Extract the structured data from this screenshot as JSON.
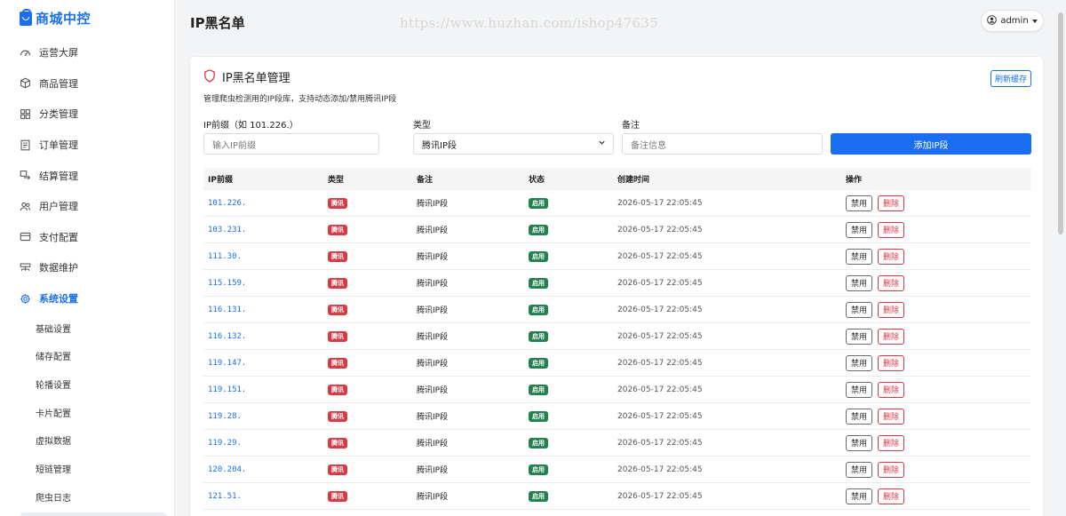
{
  "app": {
    "title": "商城中控"
  },
  "sidebar": {
    "items": [
      {
        "label": "运营大屏",
        "icon": "dashboard-icon"
      },
      {
        "label": "商品管理",
        "icon": "box-icon"
      },
      {
        "label": "分类管理",
        "icon": "grid-icon"
      },
      {
        "label": "订单管理",
        "icon": "receipt-icon"
      },
      {
        "label": "结算管理",
        "icon": "exchange-icon"
      },
      {
        "label": "用户管理",
        "icon": "users-icon"
      },
      {
        "label": "支付配置",
        "icon": "card-icon"
      },
      {
        "label": "数据维护",
        "icon": "server-icon"
      },
      {
        "label": "系统设置",
        "icon": "gear-icon",
        "active": true
      }
    ],
    "sub_items": [
      "基础设置",
      "储存配置",
      "轮播设置",
      "卡片配置",
      "虚拟数据",
      "短链管理",
      "爬虫日志"
    ]
  },
  "header": {
    "page_title": "IP黑名单",
    "watermark": "https://www.huzhan.com/ishop47635",
    "user": "admin"
  },
  "card": {
    "title": "IP黑名单管理",
    "description": "管理爬虫检测用的IP段库，支持动态添加/禁用腾讯IP段",
    "refresh_label": "刷新缓存"
  },
  "form": {
    "prefix_label": "IP前缀（如 101.226.）",
    "prefix_placeholder": "输入IP前缀",
    "type_label": "类型",
    "type_value": "腾讯IP段",
    "note_label": "备注",
    "note_placeholder": "备注信息",
    "add_label": "添加IP段"
  },
  "table": {
    "headers": [
      "IP前缀",
      "类型",
      "备注",
      "状态",
      "创建时间",
      "操作"
    ],
    "rows": [
      {
        "prefix": "101.226.",
        "type": "腾讯",
        "note": "腾讯IP段",
        "status": "启用",
        "time": "2026-05-17 22:05:45"
      },
      {
        "prefix": "103.231.",
        "type": "腾讯",
        "note": "腾讯IP段",
        "status": "启用",
        "time": "2026-05-17 22:05:45"
      },
      {
        "prefix": "111.30.",
        "type": "腾讯",
        "note": "腾讯IP段",
        "status": "启用",
        "time": "2026-05-17 22:05:45"
      },
      {
        "prefix": "115.159.",
        "type": "腾讯",
        "note": "腾讯IP段",
        "status": "启用",
        "time": "2026-05-17 22:05:45"
      },
      {
        "prefix": "116.131.",
        "type": "腾讯",
        "note": "腾讯IP段",
        "status": "启用",
        "time": "2026-05-17 22:05:45"
      },
      {
        "prefix": "116.132.",
        "type": "腾讯",
        "note": "腾讯IP段",
        "status": "启用",
        "time": "2026-05-17 22:05:45"
      },
      {
        "prefix": "119.147.",
        "type": "腾讯",
        "note": "腾讯IP段",
        "status": "启用",
        "time": "2026-05-17 22:05:45"
      },
      {
        "prefix": "119.151.",
        "type": "腾讯",
        "note": "腾讯IP段",
        "status": "启用",
        "time": "2026-05-17 22:05:45"
      },
      {
        "prefix": "119.28.",
        "type": "腾讯",
        "note": "腾讯IP段",
        "status": "启用",
        "time": "2026-05-17 22:05:45"
      },
      {
        "prefix": "119.29.",
        "type": "腾讯",
        "note": "腾讯IP段",
        "status": "启用",
        "time": "2026-05-17 22:05:45"
      },
      {
        "prefix": "120.204.",
        "type": "腾讯",
        "note": "腾讯IP段",
        "status": "启用",
        "time": "2026-05-17 22:05:45"
      },
      {
        "prefix": "121.51.",
        "type": "腾讯",
        "note": "腾讯IP段",
        "status": "启用",
        "time": "2026-05-17 22:05:45"
      }
    ],
    "disable_label": "禁用",
    "delete_label": "删除"
  },
  "colors": {
    "primary": "#1a6ff0",
    "danger": "#d63a45",
    "success": "#23804f"
  }
}
